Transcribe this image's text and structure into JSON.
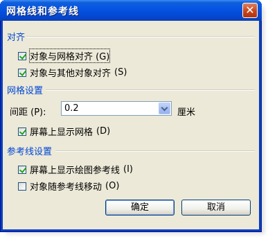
{
  "window": {
    "title": "网格线和参考线",
    "close_symbol": "✕"
  },
  "sections": {
    "align": {
      "heading": "对齐",
      "items": [
        {
          "label": "对象与网格对齐 ",
          "mnemonic": "(G)",
          "checked": true,
          "focused": true
        },
        {
          "label": "对象与其他对象对齐 ",
          "mnemonic": "(S)",
          "checked": true
        }
      ]
    },
    "grid": {
      "heading": "网格设置",
      "spacing_label": "间距 ",
      "spacing_mnemonic": "(P)",
      "spacing_colon": ":",
      "spacing_value": "0.2",
      "unit": "厘米",
      "show_grid": {
        "label": "屏幕上显示网格 ",
        "mnemonic": "(D)",
        "checked": true
      }
    },
    "guides": {
      "heading": "参考线设置",
      "items": [
        {
          "label": "屏幕上显示绘图参考线 ",
          "mnemonic": "(I)",
          "checked": true
        },
        {
          "label": "对象随参考线移动 ",
          "mnemonic": "(O)",
          "checked": false
        }
      ]
    }
  },
  "buttons": {
    "ok": "确定",
    "cancel": "取消"
  }
}
